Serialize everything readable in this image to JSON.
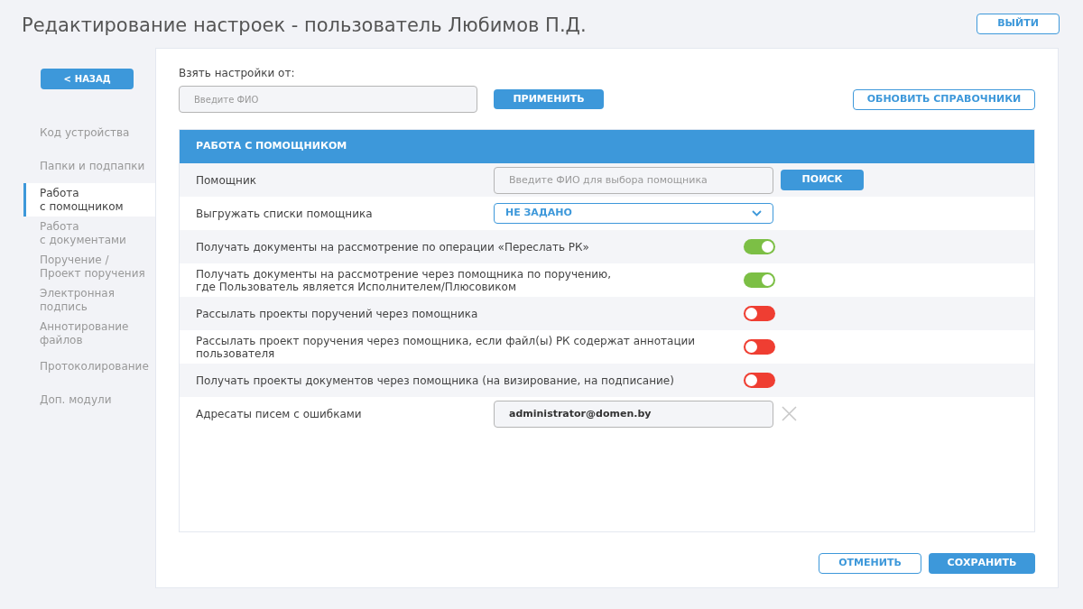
{
  "title": "Редактирование настроек - пользователь Любимов П.Д.",
  "logout_button": "ВЫЙТИ",
  "back_button": {
    "icon": "<",
    "label": "НАЗАД"
  },
  "sidebar": {
    "items": [
      {
        "label": "Код устройства",
        "selected": false
      },
      {
        "label": "Папки и подпапки",
        "selected": false
      },
      {
        "label": "Работа\nс помощником",
        "selected": true
      },
      {
        "label": "Работа\nс документами",
        "selected": false
      },
      {
        "label": "Поручение /\nПроект поручения",
        "selected": false
      },
      {
        "label": "Электронная\nподпись",
        "selected": false
      },
      {
        "label": "Аннотирование\nфайлов",
        "selected": false
      },
      {
        "label": "Протоколирование",
        "selected": false
      },
      {
        "label": "Доп. модули",
        "selected": false
      }
    ]
  },
  "copy_settings": {
    "label": "Взять настройки от:",
    "placeholder": "Введите ФИО",
    "apply_button": "ПРИМЕНИТЬ",
    "refresh_button": "ОБНОВИТЬ СПРАВОЧНИКИ"
  },
  "section": {
    "title": "РАБОТА С ПОМОЩНИКОМ",
    "rows": [
      {
        "kind": "search",
        "label": "Помощник",
        "placeholder": "Введите ФИО для выбора помощника",
        "button": "ПОИСК"
      },
      {
        "kind": "dropdown",
        "label": "Выгружать списки помощника",
        "value": "НЕ ЗАДАНО"
      },
      {
        "kind": "toggle",
        "label": "Получать документы на рассмотрение по операции «Переслать РК»",
        "on": true
      },
      {
        "kind": "toggle",
        "label": "Получать документы на рассмотрение через помощника по поручению,\nгде Пользователь является Исполнителем/Плюсовиком",
        "on": true
      },
      {
        "kind": "toggle",
        "label": "Рассылать проекты поручений через помощника",
        "on": false
      },
      {
        "kind": "toggle",
        "label": "Рассылать проект поручения через помощника, если файл(ы) РК содержат аннотации\nпользователя",
        "on": false
      },
      {
        "kind": "toggle",
        "label": "Получать проекты документов через помощника (на визирование, на подписание)",
        "on": false
      },
      {
        "kind": "email",
        "label": "Адресаты писем с ошибками",
        "value": "administrator@domen.by"
      }
    ]
  },
  "footer": {
    "cancel_button": "ОТМЕНИТЬ",
    "save_button": "СОХРАНИТЬ"
  }
}
